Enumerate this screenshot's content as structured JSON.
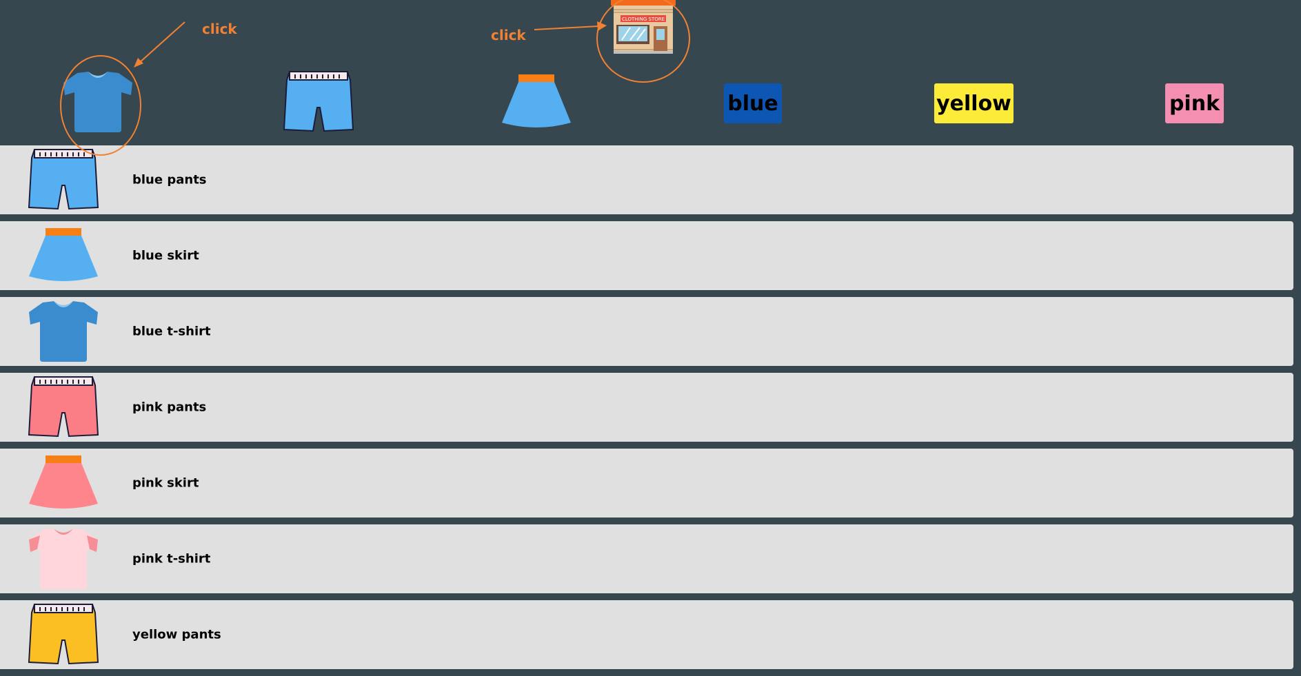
{
  "annotations": {
    "click_left": "click",
    "click_right": "click"
  },
  "filters": {
    "tshirt_icon": "tshirt-icon",
    "pants_icon": "pants-icon",
    "skirt_icon": "skirt-icon",
    "store_icon": "clothing-store-icon",
    "store_sign": "CLOTHING STORE"
  },
  "colors": [
    {
      "label": "blue",
      "bg": "#0d56b3"
    },
    {
      "label": "yellow",
      "bg": "#fdeb3a"
    },
    {
      "label": "pink",
      "bg": "#f48fb1"
    }
  ],
  "items": [
    {
      "label": "blue pants",
      "icon": "pants-icon",
      "color": "#55aff0"
    },
    {
      "label": "blue skirt",
      "icon": "skirt-icon",
      "color": "#55aff0"
    },
    {
      "label": "blue t-shirt",
      "icon": "tshirt-icon",
      "color": "#3a8ccf"
    },
    {
      "label": "pink pants",
      "icon": "pants-icon",
      "color": "#fb7d86"
    },
    {
      "label": "pink skirt",
      "icon": "skirt-icon",
      "color": "#ff858c"
    },
    {
      "label": "pink t-shirt",
      "icon": "tshirt-icon",
      "color": "#ffd6db"
    },
    {
      "label": "yellow pants",
      "icon": "pants-icon",
      "color": "#fbbf24"
    }
  ]
}
